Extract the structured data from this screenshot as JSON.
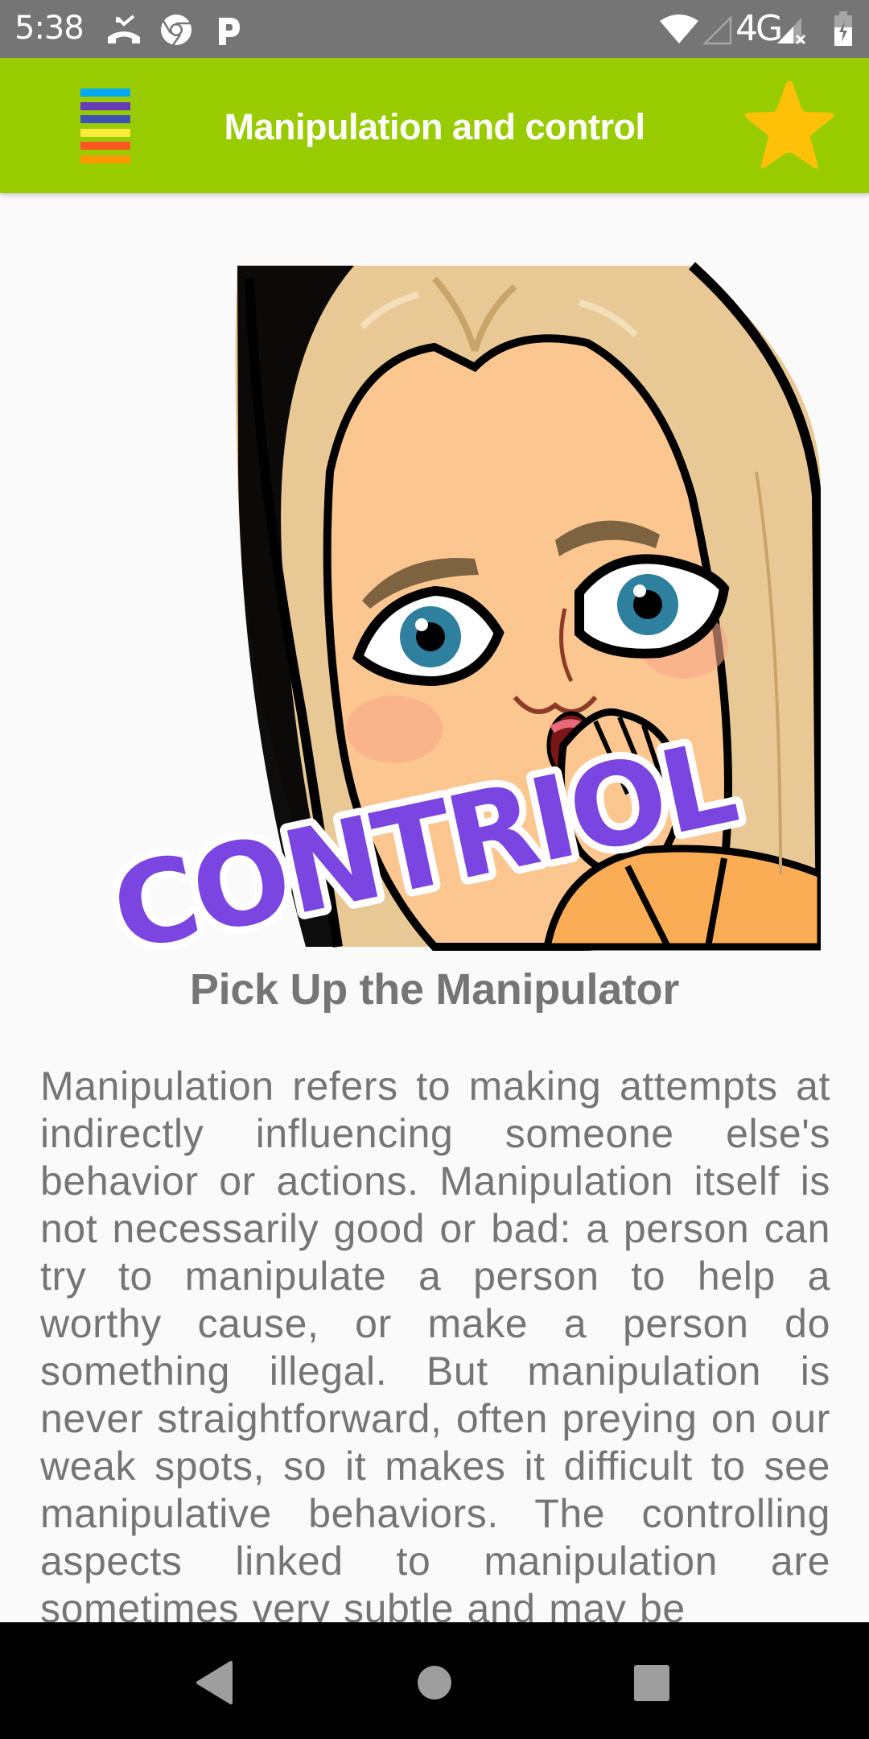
{
  "status_bar": {
    "time": "5:38",
    "left_icons": [
      "missed-call-icon",
      "chrome-icon",
      "parking-p-icon"
    ],
    "network_label": "4G",
    "right_icons": [
      "wifi-icon",
      "signal-empty-icon",
      "signal-no-sim-icon",
      "battery-charging-icon"
    ]
  },
  "app_bar": {
    "title": "Manipulation and control",
    "menu_icon": "rainbow-menu-icon",
    "menu_colors": [
      "#03a9f4",
      "#673ab7",
      "#3f51b5",
      "#ffeb3b",
      "#ff5722",
      "#ff9800"
    ],
    "favorite_icon": "star-icon",
    "star_color": "#ffc107",
    "background_color": "#99cc00"
  },
  "article": {
    "image": {
      "description": "cartoon blonde woman covering mouth in surprise",
      "overlay_text": "CONTRIOL",
      "overlay_color": "#7a45e0"
    },
    "title": "Pick Up the Manipulator",
    "body": "Manipulation refers to making attempts at indirectly influencing someone else's behavior or actions. Manipulation itself is not necessarily good or bad: a person can try to manipulate a person to help a worthy cause, or make a person do something illegal. But manipulation is never straightforward, often preying on our weak spots, so it makes it difficult to see manipulative behaviors. The controlling aspects linked to manipulation are sometimes very subtle and may be"
  },
  "nav_bar": {
    "buttons": [
      {
        "name": "back",
        "icon": "back-triangle-icon"
      },
      {
        "name": "home",
        "icon": "home-circle-icon"
      },
      {
        "name": "recents",
        "icon": "recents-square-icon"
      }
    ]
  }
}
